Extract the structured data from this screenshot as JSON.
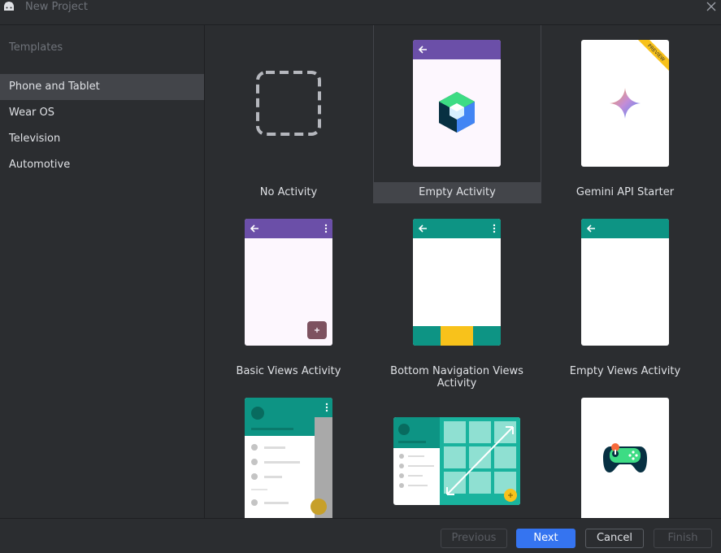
{
  "window": {
    "title": "New Project"
  },
  "sidebar": {
    "header": "Templates",
    "items": [
      {
        "label": "Phone and Tablet",
        "selected": true
      },
      {
        "label": "Wear OS",
        "selected": false
      },
      {
        "label": "Television",
        "selected": false
      },
      {
        "label": "Automotive",
        "selected": false
      }
    ]
  },
  "templates": [
    {
      "label": "No Activity"
    },
    {
      "label": "Empty Activity",
      "selected": true
    },
    {
      "label": "Gemini API Starter",
      "badge": "PREVIEW"
    },
    {
      "label": "Basic Views Activity"
    },
    {
      "label": "Bottom Navigation Views Activity"
    },
    {
      "label": "Empty Views Activity"
    }
  ],
  "colors": {
    "accent": "#3574f0",
    "purple_appbar": "#6b4fa8",
    "teal_appbar": "#0d9484",
    "yellow": "#f8c21b",
    "fab": "#7d5260"
  },
  "footer": {
    "previous_label": "Previous",
    "next_label": "Next",
    "cancel_label": "Cancel",
    "finish_label": "Finish"
  }
}
